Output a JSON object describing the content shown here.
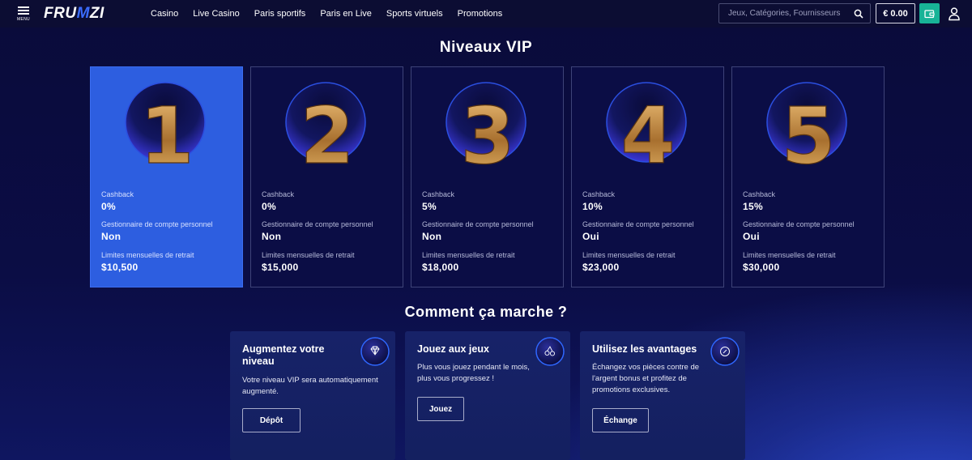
{
  "header": {
    "menu_label": "MENU",
    "logo_text_left": "FRU",
    "logo_text_mid": "M",
    "logo_text_right": "ZI",
    "nav": [
      "Casino",
      "Live Casino",
      "Paris sportifs",
      "Paris en Live",
      "Sports virtuels",
      "Promotions"
    ],
    "search_placeholder": "Jeux, Catégories, Fournisseurs",
    "balance": "€ 0.00",
    "icons": {
      "menu": "hamburger-icon",
      "search": "search-icon",
      "wallet": "wallet-icon",
      "user": "user-icon"
    }
  },
  "vip": {
    "title": "Niveaux VIP",
    "labels": {
      "cashback": "Cashback",
      "manager": "Gestionnaire de compte personnel",
      "withdraw": "Limites mensuelles de retrait"
    },
    "levels": [
      {
        "number": "1",
        "cashback": "0%",
        "manager": "Non",
        "withdraw": "$10,500",
        "active": true
      },
      {
        "number": "2",
        "cashback": "0%",
        "manager": "Non",
        "withdraw": "$15,000",
        "active": false
      },
      {
        "number": "3",
        "cashback": "5%",
        "manager": "Non",
        "withdraw": "$18,000",
        "active": false
      },
      {
        "number": "4",
        "cashback": "10%",
        "manager": "Oui",
        "withdraw": "$23,000",
        "active": false
      },
      {
        "number": "5",
        "cashback": "15%",
        "manager": "Oui",
        "withdraw": "$30,000",
        "active": false
      }
    ]
  },
  "how": {
    "title": "Comment ça marche ?",
    "cards": [
      {
        "title": "Augmentez votre niveau",
        "text": "Votre niveau VIP sera automatiquement augmenté.",
        "button": "Dépôt",
        "icon": "diamond-icon"
      },
      {
        "title": "Jouez aux jeux",
        "text": "Plus vous jouez pendant le mois, plus vous progressez !",
        "button": "Jouez",
        "icon": "cherries-icon"
      },
      {
        "title": "Utilisez les avantages",
        "text": "Échangez vos pièces contre de l'argent bonus et profitez de promotions exclusives.",
        "button": "Échange",
        "icon": "coin-icon"
      }
    ]
  },
  "colors": {
    "background": "#0b0d45",
    "active_card": "#2d5ee0",
    "wallet": "#18b397",
    "gold": "#c9994a"
  }
}
